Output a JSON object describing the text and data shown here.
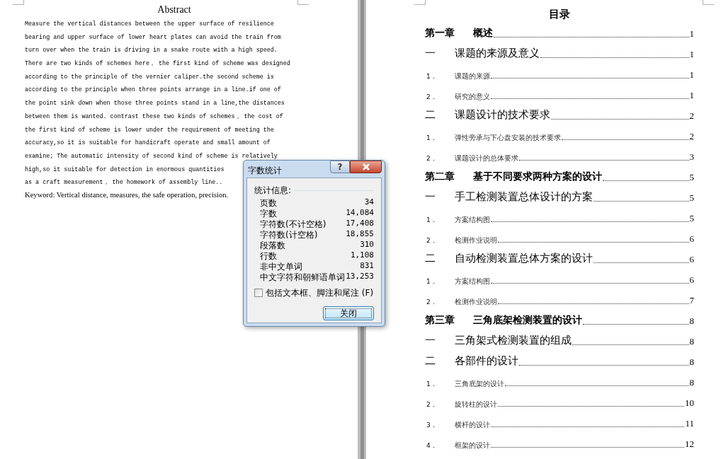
{
  "abstract": {
    "title": "Abstract",
    "lines": [
      {
        "text": "Measure the vertical distances between the upper surface of resilience"
      },
      {
        "text": "bearing and upper surface of lower heart plates can avoid the train from"
      },
      {
        "text": "turn over when the train is driving in a snake route with a high speed."
      },
      {
        "text": "There are two kinds of schemes here， the first kind of scheme was designed"
      },
      {
        "text": "according to the principle of the vernier caliper.the second scheme is"
      },
      {
        "text": "according to the principle when three points arrange in a line.if one of"
      },
      {
        "text": "the point sink down when those three points stand in a line,the distances"
      },
      {
        "text": "between them is wanted. contrast these two kinds of schemes， the cost of"
      },
      {
        "text": "the first kind of scheme is lower under the requirement of meeting the"
      },
      {
        "text": "accuracy,so it is suitable for handicraft operate and small amount of"
      },
      {
        "text": "examine; The automatic intensity of second kind of scheme is relatively"
      },
      {
        "text": "high,so it suitable for detection in enormous quantities"
      },
      {
        "text": "as a craft measurement， the homework of assembly line.."
      }
    ],
    "keyword": "Keyword: Vertical distance, measures, the safe operation, precision."
  },
  "toc": {
    "title": "目录",
    "entries": [
      {
        "kind": "chapter",
        "number": "第一章",
        "text": "概述",
        "page": "1"
      },
      {
        "kind": "section",
        "number": "一",
        "text": "课题的来源及意义",
        "page": "1"
      },
      {
        "kind": "item",
        "number": "1．",
        "text": "课题的来源",
        "page": "1"
      },
      {
        "kind": "item",
        "number": "2．",
        "text": "研究的意义",
        "page": "1"
      },
      {
        "kind": "section",
        "number": "二",
        "text": "课题设计的技术要求",
        "page": "2"
      },
      {
        "kind": "item",
        "number": "1．",
        "text": "弹性旁承与下心盘安装的技术要求",
        "page": "2"
      },
      {
        "kind": "item",
        "number": "2．",
        "text": "课题设计的总体要求",
        "page": "3"
      },
      {
        "kind": "chapter",
        "number": "第二章",
        "text": "基于不同要求两种方案的设计",
        "page": "5"
      },
      {
        "kind": "section",
        "number": "一",
        "text": "手工检测装置总体设计的方案",
        "page": "5"
      },
      {
        "kind": "item",
        "number": "1．",
        "text": "方案结构图",
        "page": "5"
      },
      {
        "kind": "item",
        "number": "2．",
        "text": "检测作业说明",
        "page": "6"
      },
      {
        "kind": "section",
        "number": "二",
        "text": "自动检测装置总体方案的设计",
        "page": "6"
      },
      {
        "kind": "item",
        "number": "1．",
        "text": "方案结构图",
        "page": "6"
      },
      {
        "kind": "item",
        "number": "2．",
        "text": "检测作业说明",
        "page": "7"
      },
      {
        "kind": "chapter",
        "number": "第三章",
        "text": "三角底架检测装置的设计",
        "page": "8"
      },
      {
        "kind": "section",
        "number": "一",
        "text": "三角架式检测装置的组成",
        "page": "8"
      },
      {
        "kind": "section",
        "number": "二",
        "text": "各部件的设计",
        "page": "8"
      },
      {
        "kind": "item",
        "number": "1．",
        "text": "三角底架的设计",
        "page": "8"
      },
      {
        "kind": "item",
        "number": "2．",
        "text": "旋转柱的设计",
        "page": "10"
      },
      {
        "kind": "item",
        "number": "3．",
        "text": "横杆的设计",
        "page": "11"
      },
      {
        "kind": "item",
        "number": "4．",
        "text": "框架的设计",
        "page": "12"
      }
    ]
  },
  "dialog": {
    "title": "字数统计",
    "help": "?",
    "group_label": "统计信息:",
    "stats": [
      {
        "label": "页数",
        "value": "34"
      },
      {
        "label": "字数",
        "value": "14,084"
      },
      {
        "label": "字符数(不计空格)",
        "value": "17,408"
      },
      {
        "label": "字符数(计空格)",
        "value": "18,855"
      },
      {
        "label": "段落数",
        "value": "310"
      },
      {
        "label": "行数",
        "value": "1,108"
      },
      {
        "label": "非中文单词",
        "value": "831"
      },
      {
        "label": "中文字符和朝鲜语单词",
        "value": "13,253"
      }
    ],
    "checkbox": {
      "label": "包括文本框、脚注和尾注",
      "shortcut": "(F)",
      "checked": false
    },
    "close_button": "关闭"
  }
}
